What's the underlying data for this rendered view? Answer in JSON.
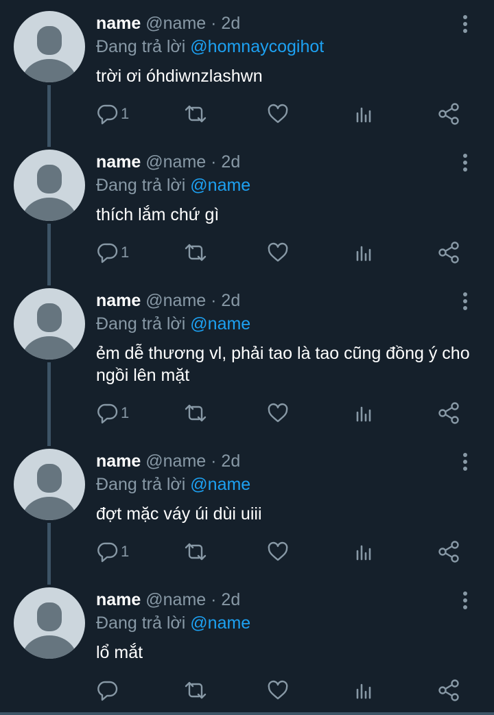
{
  "labels": {
    "replying_prefix": "Đang trả lời"
  },
  "colors": {
    "background": "#15202b",
    "accent": "#1da1f2",
    "muted": "#8899a6",
    "thread_line": "#3d5466"
  },
  "icons": [
    "more-vertical-icon",
    "reply-icon",
    "retweet-icon",
    "like-icon",
    "analytics-icon",
    "share-icon"
  ],
  "tweets": [
    {
      "name": "name",
      "handle": "@name",
      "dot": "·",
      "time": "2d",
      "mention": "@homnaycogihot",
      "text": "trời ơi óhdiwnzlashwn",
      "replies": "1"
    },
    {
      "name": "name",
      "handle": "@name",
      "dot": "·",
      "time": "2d",
      "mention": "@name",
      "text": "thích lắm chứ gì",
      "replies": "1"
    },
    {
      "name": "name",
      "handle": "@name",
      "dot": "·",
      "time": "2d",
      "mention": "@name",
      "text": "ẻm dễ thương vl, phải tao là tao cũng đồng ý cho ngồi lên mặt",
      "replies": "1"
    },
    {
      "name": "name",
      "handle": "@name",
      "dot": "·",
      "time": "2d",
      "mention": "@name",
      "text": "đợt mặc váy úi dùi uiii",
      "replies": "1"
    },
    {
      "name": "name",
      "handle": "@name",
      "dot": "·",
      "time": "2d",
      "mention": "@name",
      "text": "lổ mắt",
      "replies": ""
    }
  ]
}
